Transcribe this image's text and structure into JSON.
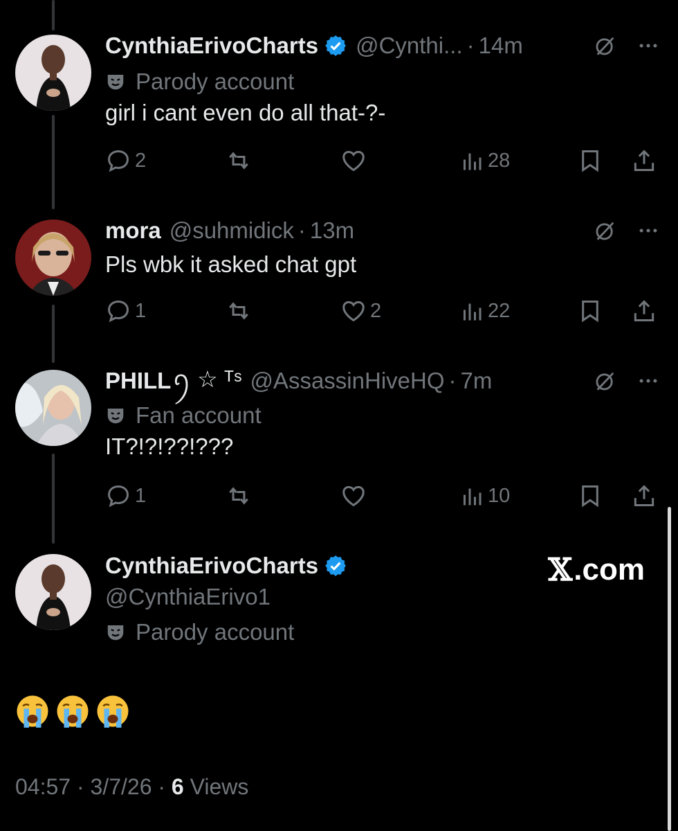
{
  "replies": [
    {
      "name": "CynthiaErivoCharts",
      "verified": true,
      "handle": "@Cynthi...",
      "time": "14m",
      "account_label": "Parody account",
      "text": "girl i cant even do all that-?-",
      "stats": {
        "replies": "2",
        "reposts": "",
        "likes": "",
        "views": "28"
      }
    },
    {
      "name": "mora",
      "verified": false,
      "handle": "@suhmidick",
      "time": "13m",
      "account_label": "",
      "text": "Pls wbk it asked chat gpt",
      "stats": {
        "replies": "1",
        "reposts": "",
        "likes": "2",
        "views": "22"
      }
    },
    {
      "name": "PHILL",
      "name_decor": "ꪆ ☆ ᵀˢ",
      "verified": false,
      "handle": "@AssassinHiveHQ",
      "time": "7m",
      "account_label": "Fan account",
      "text": "IT?!?!??!???",
      "stats": {
        "replies": "1",
        "reposts": "",
        "likes": "",
        "views": "10"
      }
    }
  ],
  "main_post": {
    "name": "CynthiaErivoCharts",
    "handle": "@CynthiaErivo1",
    "account_label": "Parody account",
    "emoji_count": 3,
    "timestamp": "04:57 · 3/7/26 · ",
    "views_count": "6",
    "views_label": "Views"
  },
  "watermark": {
    "x": "𝕏",
    "text": ".com"
  },
  "colors": {
    "background": "#000000",
    "text": "#e7e9ea",
    "muted": "#71767b",
    "verified": "#1d9bf0"
  },
  "icons": [
    "verified-badge-icon",
    "grok-icon",
    "more-icon",
    "reply-icon",
    "repost-icon",
    "like-icon",
    "views-icon",
    "bookmark-icon",
    "share-icon",
    "mask-icon",
    "crying-emoji"
  ]
}
